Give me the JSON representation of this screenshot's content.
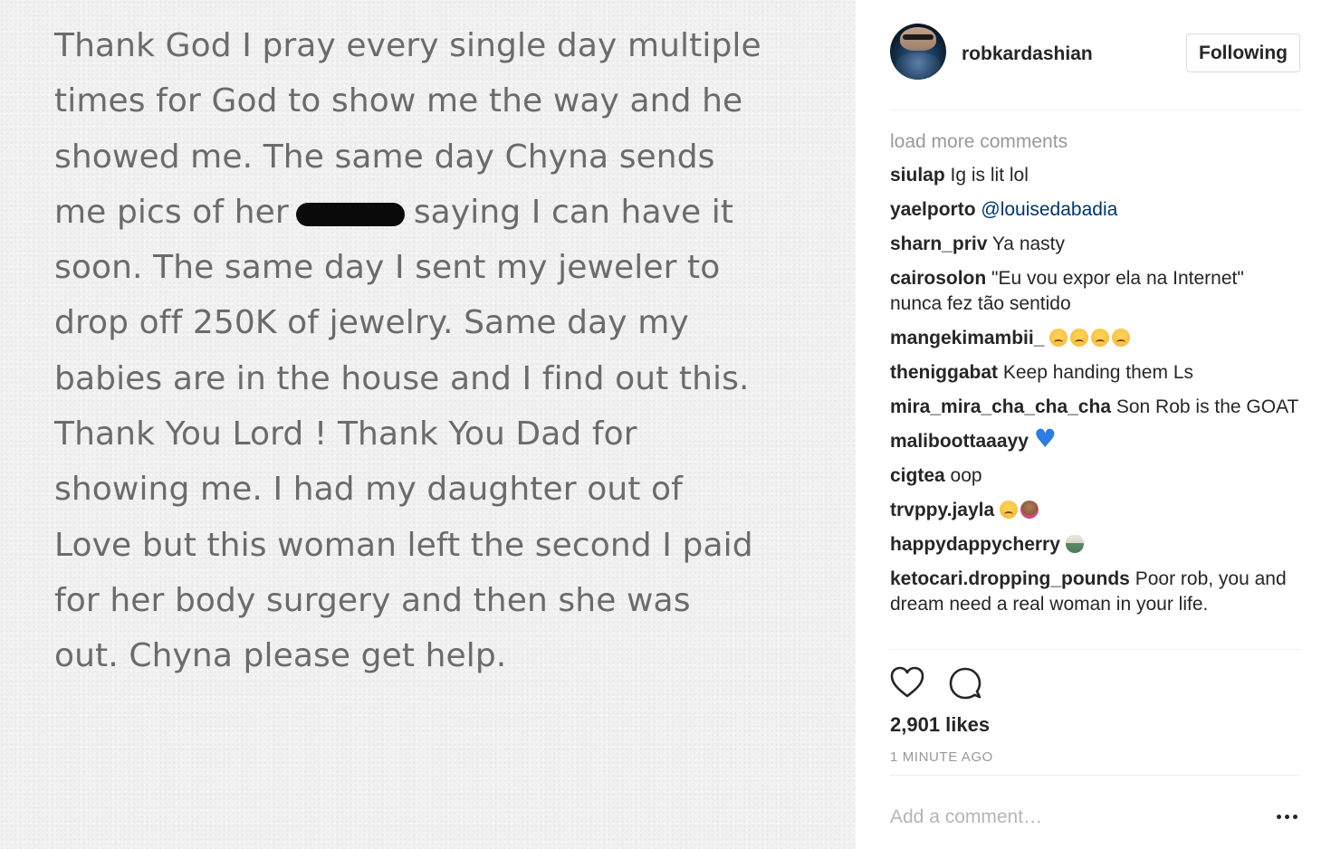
{
  "post": {
    "note_lines": [
      "Thank God I pray every single day multiple",
      "times for God to show me the way and he",
      "showed me. The same day Chyna sends",
      [
        "me pics of her",
        "saying I can have it"
      ],
      "soon. The same day I sent my jeweler to",
      "drop off 250K of jewelry. Same day my",
      "babies are in the house and I find out this.",
      "Thank You Lord ! Thank You Dad for",
      "showing me. I had my daughter out of",
      "Love but this woman left the second I paid",
      "for her body surgery and then she was",
      "out. Chyna please get help."
    ]
  },
  "header": {
    "username": "robkardashian",
    "follow_label": "Following"
  },
  "comments": {
    "load_more": "load more comments",
    "items": [
      {
        "user": "siulap",
        "text": "Ig is lit lol"
      },
      {
        "user": "yaelporto",
        "mention": "@louisedabadia"
      },
      {
        "user": "sharn_priv",
        "text": "Ya nasty"
      },
      {
        "user": "cairosolon",
        "text": "\"Eu vou expor ela na Internet\" nunca fez tão sentido"
      },
      {
        "user": "mangekimambii_",
        "emoji": [
          "crying-face-emoji",
          "crying-face-emoji",
          "crying-face-emoji",
          "crying-face-emoji"
        ]
      },
      {
        "user": "theniggabat",
        "text": "Keep handing them Ls"
      },
      {
        "user": "mira_mira_cha_cha_cha",
        "text": "Son Rob is the GOAT"
      },
      {
        "user": "maliboottaaayy",
        "emoji": [
          "blue-heart-emoji"
        ]
      },
      {
        "user": "cigtea",
        "text": "oop"
      },
      {
        "user": "trvppy.jayla",
        "emoji": [
          "loudly-crying-face-emoji",
          "person-facepalming-emoji"
        ]
      },
      {
        "user": "happydappycherry",
        "emoji": [
          "bowl-emoji"
        ]
      },
      {
        "user": "ketocari.dropping_pounds",
        "text": "Poor rob, you and dream need a real woman in your life."
      }
    ]
  },
  "actions": {
    "likes": "2,901 likes",
    "timestamp": "1 MINUTE AGO"
  },
  "add_comment": {
    "placeholder": "Add a comment…"
  },
  "colors": {
    "mention": "#003569",
    "muted": "#999999",
    "text": "#262626",
    "note_text": "#6b6b6b"
  }
}
